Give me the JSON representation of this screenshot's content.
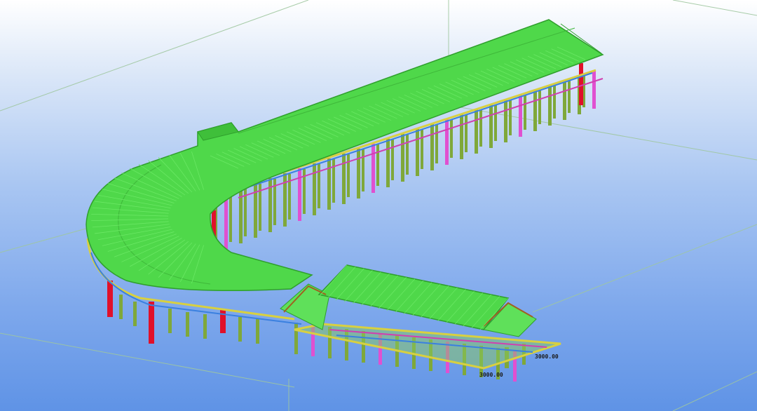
{
  "viewport": {
    "colors": {
      "roof": "#4fd84a",
      "roof_edge": "#2f9f2c",
      "column": "#7fa83a",
      "column_red": "#e0102a",
      "column_magenta": "#e050d0",
      "beam_yellow": "#d8d040",
      "beam_blue": "#3a80e0",
      "beam_magenta": "#d040b0",
      "grid_line": "#9fc79f"
    },
    "labels": {
      "elevation_a": "3000.00",
      "elevation_b": "3000.00"
    }
  }
}
